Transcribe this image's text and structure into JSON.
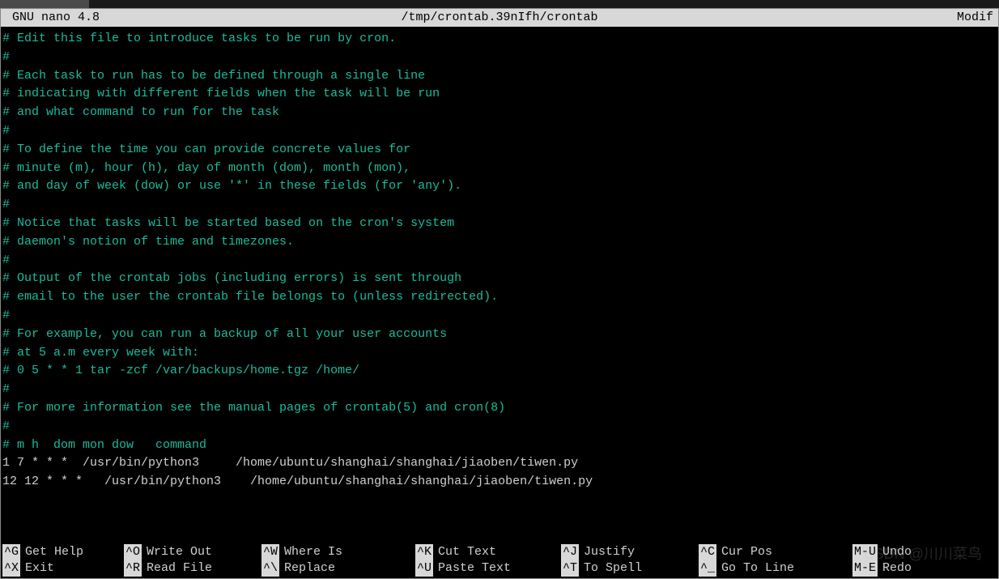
{
  "header": {
    "editor_name": "GNU nano 4.8",
    "file_path": "/tmp/crontab.39nIfh/crontab",
    "status": "Modif"
  },
  "content_lines": [
    {
      "type": "comment",
      "text": "# Edit this file to introduce tasks to be run by cron."
    },
    {
      "type": "comment",
      "text": "#"
    },
    {
      "type": "comment",
      "text": "# Each task to run has to be defined through a single line"
    },
    {
      "type": "comment",
      "text": "# indicating with different fields when the task will be run"
    },
    {
      "type": "comment",
      "text": "# and what command to run for the task"
    },
    {
      "type": "comment",
      "text": "#"
    },
    {
      "type": "comment",
      "text": "# To define the time you can provide concrete values for"
    },
    {
      "type": "comment",
      "text": "# minute (m), hour (h), day of month (dom), month (mon),"
    },
    {
      "type": "comment",
      "text": "# and day of week (dow) or use '*' in these fields (for 'any')."
    },
    {
      "type": "comment",
      "text": "#"
    },
    {
      "type": "comment",
      "text": "# Notice that tasks will be started based on the cron's system"
    },
    {
      "type": "comment",
      "text": "# daemon's notion of time and timezones."
    },
    {
      "type": "comment",
      "text": "#"
    },
    {
      "type": "comment",
      "text": "# Output of the crontab jobs (including errors) is sent through"
    },
    {
      "type": "comment",
      "text": "# email to the user the crontab file belongs to (unless redirected)."
    },
    {
      "type": "comment",
      "text": "#"
    },
    {
      "type": "comment",
      "text": "# For example, you can run a backup of all your user accounts"
    },
    {
      "type": "comment",
      "text": "# at 5 a.m every week with:"
    },
    {
      "type": "comment",
      "text": "# 0 5 * * 1 tar -zcf /var/backups/home.tgz /home/"
    },
    {
      "type": "comment",
      "text": "#"
    },
    {
      "type": "comment",
      "text": "# For more information see the manual pages of crontab(5) and cron(8)"
    },
    {
      "type": "comment",
      "text": "#"
    },
    {
      "type": "comment",
      "text": "# m h  dom mon dow   command"
    },
    {
      "type": "plain",
      "text": "1 7 * * *  /usr/bin/python3     /home/ubuntu/shanghai/shanghai/jiaoben/tiwen.py"
    },
    {
      "type": "plain",
      "text": "12 12 * * *   /usr/bin/python3    /home/ubuntu/shanghai/shanghai/jiaoben/tiwen.py"
    }
  ],
  "shortcuts_row1": [
    {
      "key": "^G",
      "label": "Get Help"
    },
    {
      "key": "^O",
      "label": "Write Out"
    },
    {
      "key": "^W",
      "label": "Where Is"
    },
    {
      "key": "^K",
      "label": "Cut Text"
    },
    {
      "key": "^J",
      "label": "Justify"
    },
    {
      "key": "^C",
      "label": "Cur Pos"
    },
    {
      "key": "M-U",
      "label": "Undo"
    }
  ],
  "shortcuts_row2": [
    {
      "key": "^X",
      "label": "Exit"
    },
    {
      "key": "^R",
      "label": "Read File"
    },
    {
      "key": "^\\",
      "label": "Replace"
    },
    {
      "key": "^U",
      "label": "Paste Text"
    },
    {
      "key": "^T",
      "label": "To Spell"
    },
    {
      "key": "^_",
      "label": "Go To Line"
    },
    {
      "key": "M-E",
      "label": "Redo"
    }
  ],
  "watermark": "CSDN @川川菜鸟"
}
